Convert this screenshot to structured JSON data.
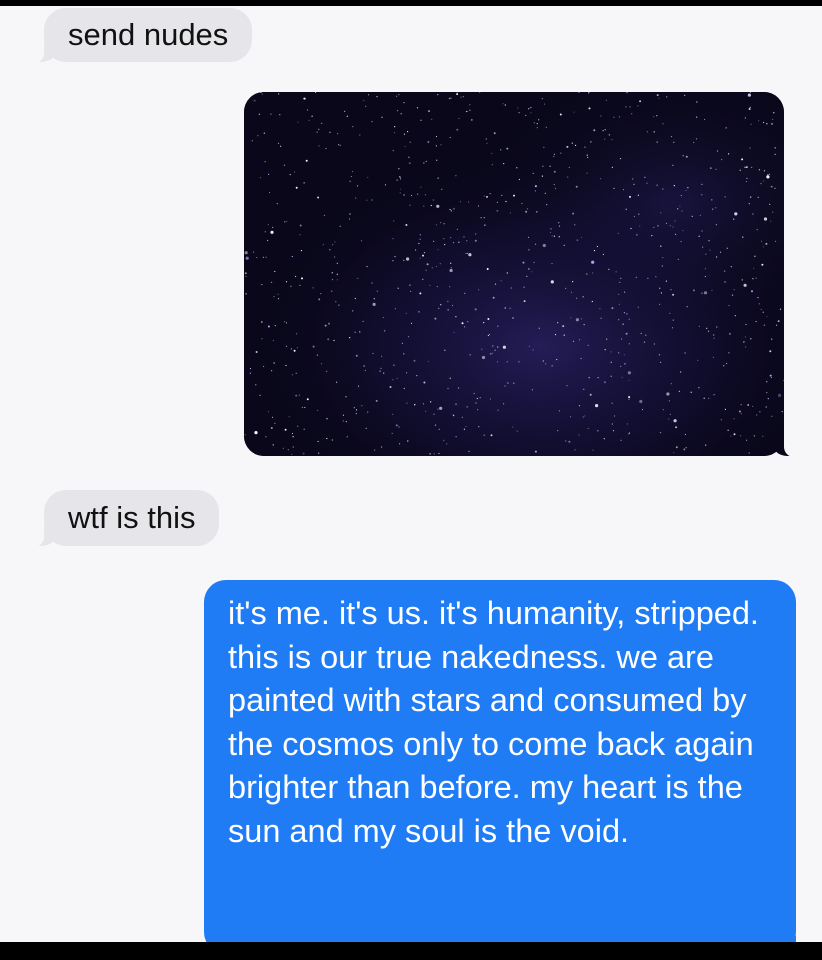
{
  "conversation": {
    "messages": [
      {
        "side": "received",
        "type": "text",
        "text": "send nudes"
      },
      {
        "side": "sent",
        "type": "image",
        "image_label": "starry-night-sky-photo"
      },
      {
        "side": "received",
        "type": "text",
        "text": "wtf is this"
      },
      {
        "side": "sent",
        "type": "text",
        "text": "it's me. it's us. it's humanity, stripped. this is our true nakedness. we are painted with stars and consumed by the cosmos only to come back again brighter than before. my heart is the sun and my soul is the void."
      }
    ]
  },
  "colors": {
    "received_bubble": "#e6e6ea",
    "sent_bubble": "#1f7cf4",
    "background": "#f7f7f9",
    "night_sky": "#090719"
  }
}
